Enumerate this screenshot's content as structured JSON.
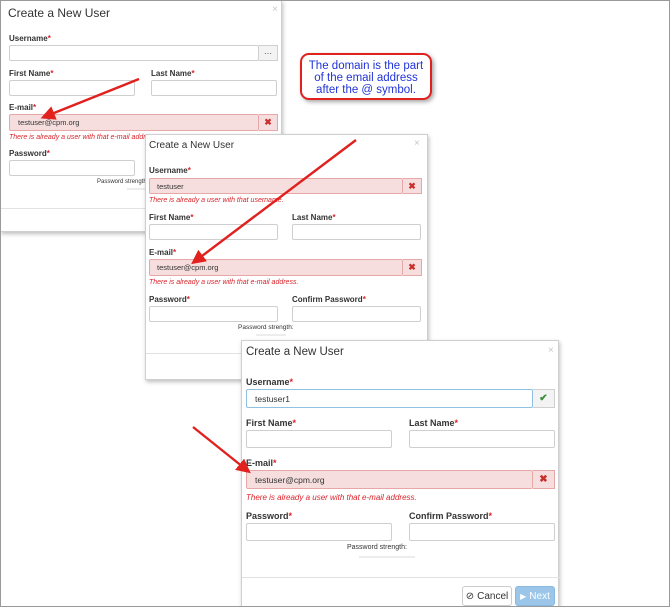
{
  "callout": {
    "text_line1": "The domain is the part",
    "text_line2": "of the email address",
    "text_line3": "after the @ symbol."
  },
  "dialog1": {
    "title": "Create a New User",
    "close": "×",
    "username_label": "Username",
    "username_value": "",
    "username_addon": "···",
    "first_name_label": "First Name",
    "last_name_label": "Last Name",
    "email_label": "E-mail",
    "email_value": "testuser@cpm.org",
    "email_error": "There is already a user with that e-mail address.",
    "password_label": "Password",
    "password_strength": "Password strength:"
  },
  "dialog2": {
    "title": "Create a New User",
    "close": "×",
    "username_label": "Username",
    "username_value": "testuser",
    "username_error": "There is already a user with that username.",
    "first_name_label": "First Name",
    "last_name_label": "Last Name",
    "email_label": "E-mail",
    "email_value": "testuser@cpm.org",
    "email_error": "There is already a user with that e-mail address.",
    "password_label": "Password",
    "confirm_password_label": "Confirm Password",
    "password_strength": "Password strength:"
  },
  "dialog3": {
    "title": "Create a New User",
    "close": "×",
    "username_label": "Username",
    "username_value": "testuser1",
    "first_name_label": "First Name",
    "last_name_label": "Last Name",
    "email_label": "E-mail",
    "email_value": "testuser@cpm.org",
    "email_error": "There is already a user with that e-mail address.",
    "password_label": "Password",
    "confirm_password_label": "Confirm Password",
    "password_strength": "Password strength:",
    "cancel_label": "Cancel",
    "next_label": "Next"
  },
  "req_mark": "*",
  "icons": {
    "error": "x-icon",
    "valid": "check-icon",
    "cancel": "cancel-icon",
    "next": "play-icon"
  },
  "colors": {
    "error": "#d9242b",
    "error_bg": "#f7dede",
    "arrow": "#e0211d",
    "callout_text": "#2134d8"
  }
}
